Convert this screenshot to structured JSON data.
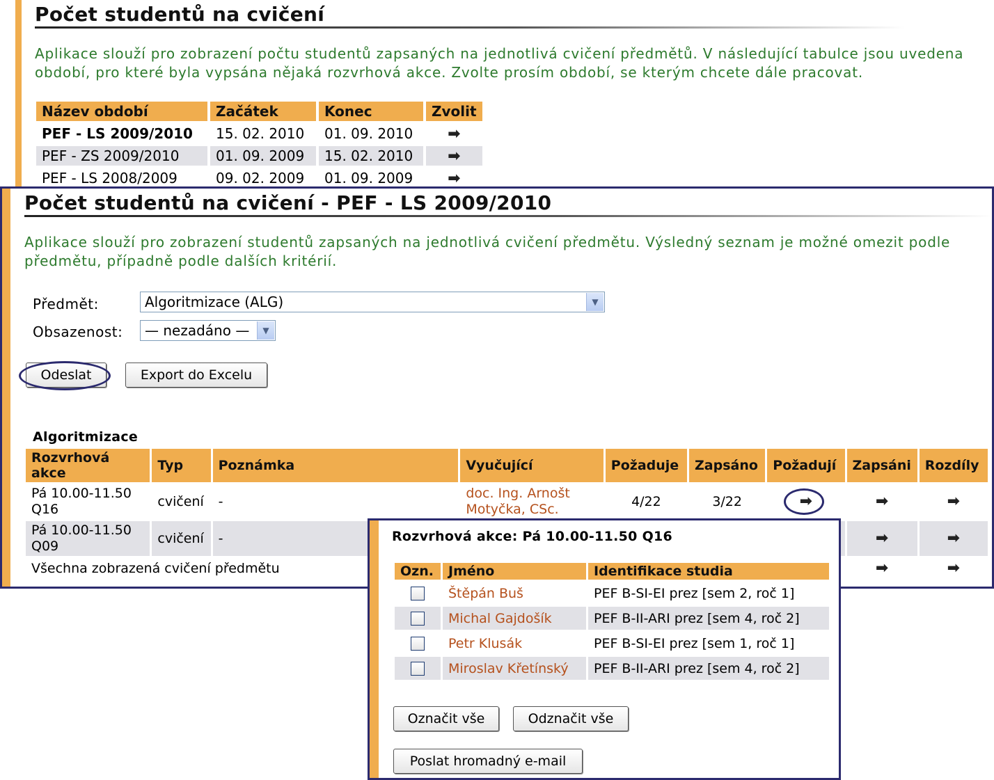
{
  "periods_panel": {
    "title": "Počet studentů na cvičení",
    "intro": "Aplikace slouží pro zobrazení počtu studentů zapsaných na jednotlivá cvičení předmětů. V následující tabulce jsou uvedena období, pro které byla vypsána nějaká rozvrhová akce. Zvolte prosím období, se kterým chcete dále pracovat.",
    "columns": [
      "Název období",
      "Začátek",
      "Konec",
      "Zvolit"
    ],
    "rows": [
      {
        "name": "PEF - LS 2009/2010",
        "start": "15. 02. 2010",
        "end": "01. 09. 2010"
      },
      {
        "name": "PEF - ZS 2009/2010",
        "start": "01. 09. 2009",
        "end": "15. 02. 2010"
      },
      {
        "name": "PEF - LS 2008/2009",
        "start": "09. 02. 2009",
        "end": "01. 09. 2009"
      }
    ]
  },
  "course_panel": {
    "title": "Počet studentů na cvičení - PEF - LS 2009/2010",
    "intro": "Aplikace slouží pro zobrazení studentů zapsaných na jednotlivá cvičení předmětu. Výsledný seznam je možné omezit podle předmětu, případně podle dalších kritérií.",
    "subject_label": "Předmět:",
    "subject_value": "Algoritmizace (ALG)",
    "occupancy_label": "Obsazenost:",
    "occupancy_value": "— nezadáno —",
    "submit_label": "Odeslat",
    "export_label": "Export do Excelu",
    "course_name": "Algoritmizace",
    "columns": [
      "Rozvrhová akce",
      "Typ",
      "Poznámka",
      "Vyučující",
      "Požaduje",
      "Zapsáno",
      "Požadují",
      "Zapsáni",
      "Rozdíly"
    ],
    "rows": [
      {
        "action": "Pá 10.00-11.50 Q16",
        "type": "cvičení",
        "note": "-",
        "teacher": "doc. Ing. Arnošt Motyčka, CSc.",
        "requires": "4/22",
        "enrolled": "3/22"
      },
      {
        "action": "Pá 10.00-11.50 Q09",
        "type": "cvičení",
        "note": "-",
        "teacher": "",
        "requires": "",
        "enrolled": ""
      }
    ],
    "summary_row": "Všechna zobrazená cvičení předmětu"
  },
  "popup": {
    "title": "Rozvrhová akce: Pá 10.00-11.50 Q16",
    "columns": [
      "Ozn.",
      "Jméno",
      "Identifikace studia"
    ],
    "students": [
      {
        "name": "Štěpán Buš",
        "study": "PEF B-SI-EI prez [sem 2, roč 1]"
      },
      {
        "name": "Michal Gajdošík",
        "study": "PEF B-II-ARI prez [sem 4, roč 2]"
      },
      {
        "name": "Petr Klusák",
        "study": "PEF B-SI-EI prez [sem 1, roč 1]"
      },
      {
        "name": "Miroslav Křetínský",
        "study": "PEF B-II-ARI prez [sem 4, roč 2]"
      }
    ],
    "select_all_label": "Označit vše",
    "deselect_all_label": "Odznačit vše",
    "mass_email_label": "Poslat hromadný e-mail"
  },
  "colors": {
    "accent": "#f0ad4e",
    "frame": "#2b2a6e",
    "intro_text": "#2d7a2d",
    "link": "#b5511d",
    "alt_row": "#e1e1e6"
  },
  "icons": {
    "select_arrow": "arrow-right-icon",
    "dropdown": "chevron-down-icon",
    "checkbox": "checkbox-icon"
  }
}
